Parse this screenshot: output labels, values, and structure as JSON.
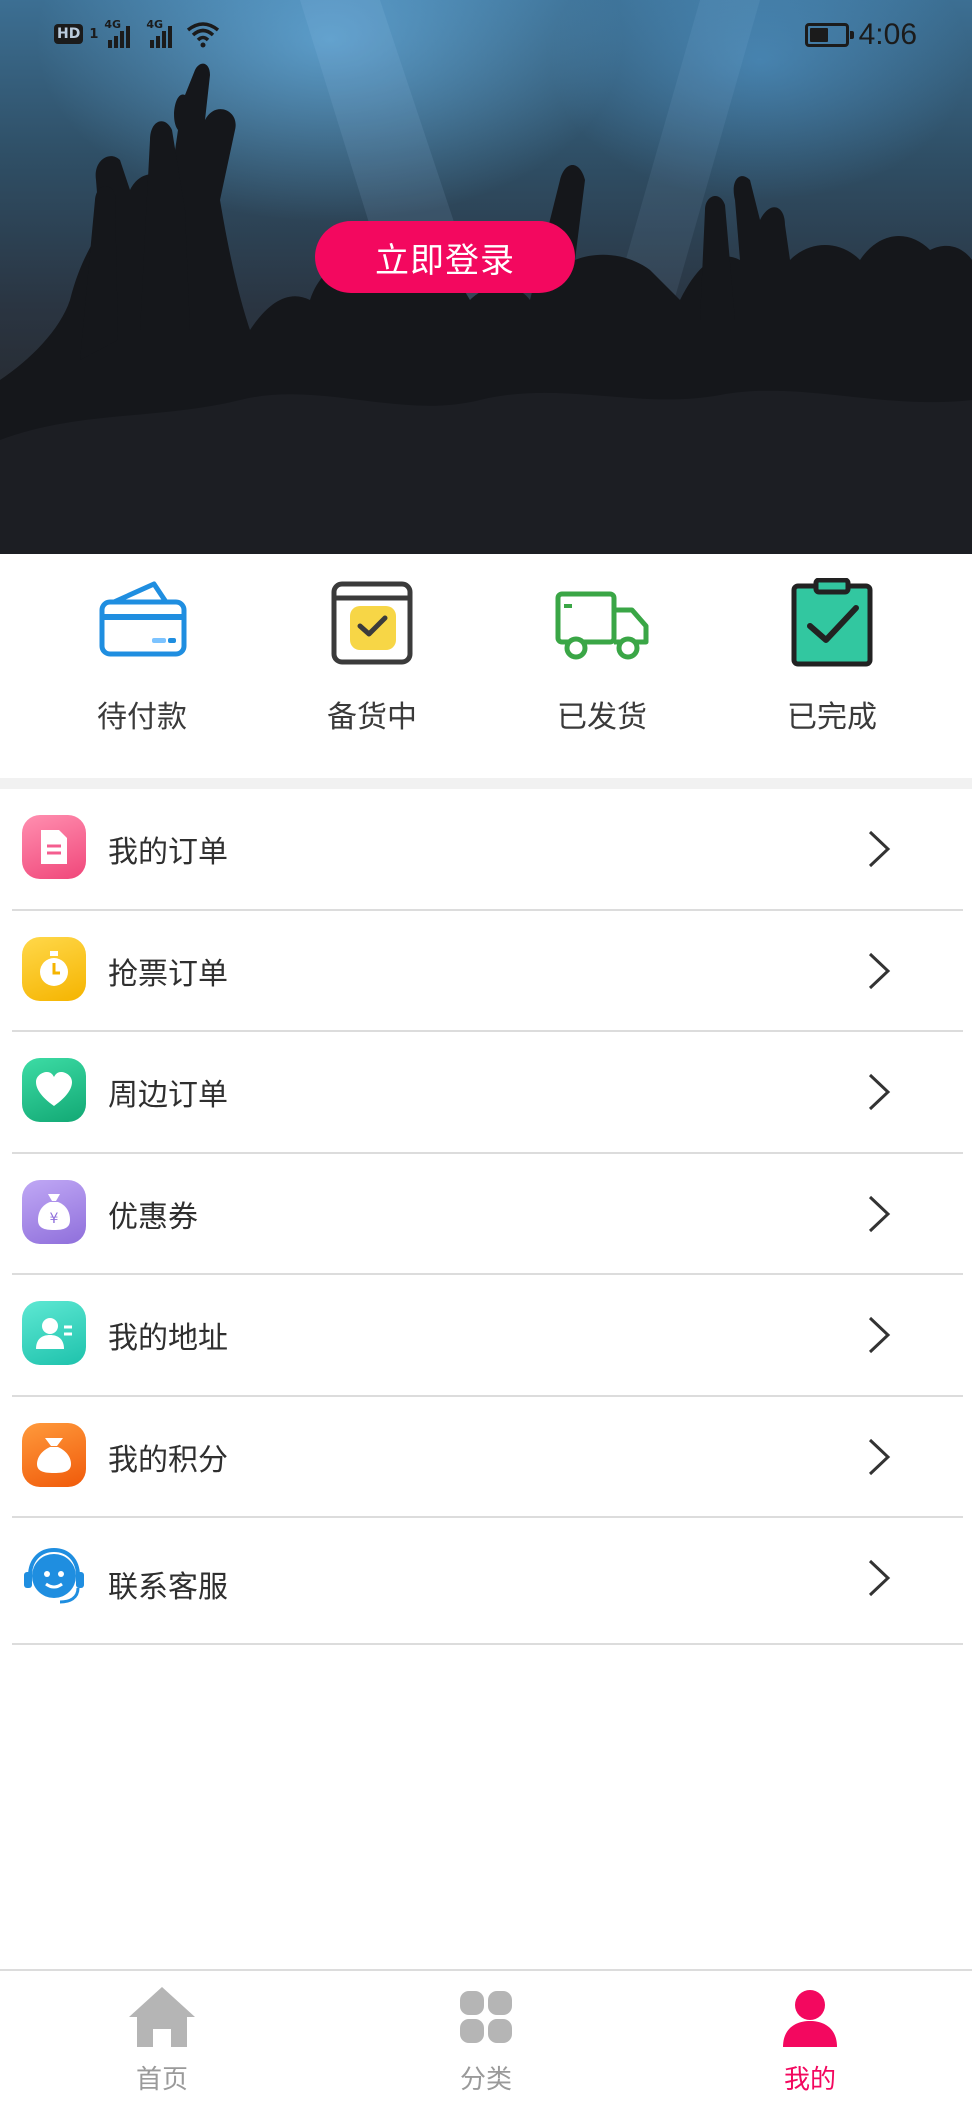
{
  "status_bar": {
    "time": "4:06",
    "hd": "HD",
    "sim": "1",
    "net1": "4G",
    "net2": "4G"
  },
  "hero": {
    "login_label": "立即登录"
  },
  "order_status": [
    {
      "label": "待付款",
      "icon": "card-icon",
      "color": "#1f8ee0"
    },
    {
      "label": "备货中",
      "icon": "calendar-check-icon",
      "color": "#f7d646"
    },
    {
      "label": "已发货",
      "icon": "truck-icon",
      "color": "#3aa646"
    },
    {
      "label": "已完成",
      "icon": "clipboard-check-icon",
      "color": "#32c7a0"
    }
  ],
  "menu": [
    {
      "label": "我的订单",
      "icon": "document-icon",
      "color": "#f45d8f"
    },
    {
      "label": "抢票订单",
      "icon": "stopwatch-icon",
      "color": "#f9c40d"
    },
    {
      "label": "周边订单",
      "icon": "heart-icon",
      "color": "#1fbf8a"
    },
    {
      "label": "优惠券",
      "icon": "money-bag-icon",
      "color": "#a889e6"
    },
    {
      "label": "我的地址",
      "icon": "contact-icon",
      "color": "#2fd0be"
    },
    {
      "label": "我的积分",
      "icon": "pouch-icon",
      "color": "#f56e14"
    },
    {
      "label": "联系客服",
      "icon": "headset-icon",
      "color": "#1f8ee0"
    }
  ],
  "tabs": [
    {
      "label": "首页",
      "icon": "home-icon"
    },
    {
      "label": "分类",
      "icon": "grid-icon"
    },
    {
      "label": "我的",
      "icon": "person-icon",
      "active_color": "#f3085f"
    }
  ],
  "accent": "#f3085f"
}
